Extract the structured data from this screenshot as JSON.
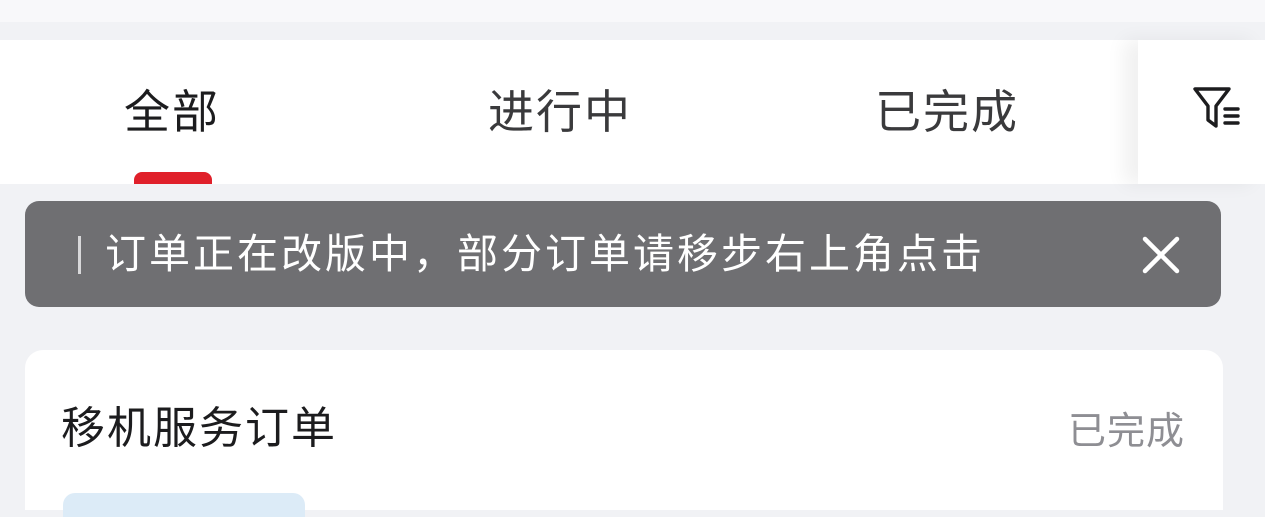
{
  "tabs": [
    {
      "label": "全部",
      "active": true
    },
    {
      "label": "进行中",
      "active": false
    },
    {
      "label": "已完成",
      "active": false
    }
  ],
  "filter": {
    "icon": "filter-icon"
  },
  "notice": {
    "text": "订单正在改版中，部分订单请移步右上角点击",
    "close_icon": "close-icon"
  },
  "order_card": {
    "title": "移机服务订单",
    "status": "已完成"
  },
  "colors": {
    "accent": "#e0202a",
    "toast_bg": "#6f6f72",
    "page_bg": "#f1f2f5"
  }
}
